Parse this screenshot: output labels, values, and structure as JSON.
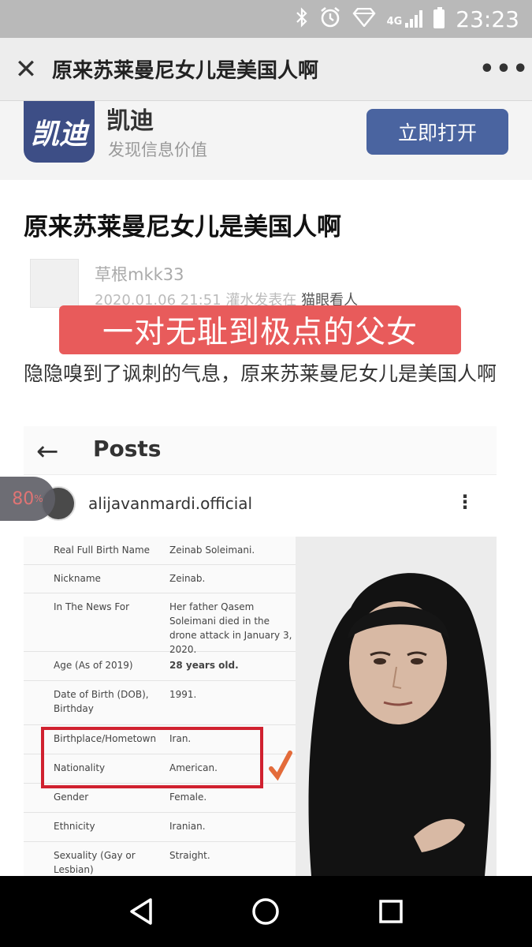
{
  "status_bar": {
    "time": "23:23",
    "network": "4G"
  },
  "title_bar": {
    "close_glyph": "✕",
    "title": "原来苏莱曼尼女儿是美国人啊",
    "more_glyph": "•••"
  },
  "banner": {
    "logo_text": "凯迪",
    "app_name": "凯迪",
    "slogan": "发现信息价值",
    "open_label": "立即打开"
  },
  "article": {
    "title": "原来苏莱曼尼女儿是美国人啊",
    "author": "草根mkk33",
    "meta_prefix": "2020.01.06 21:51 灌水发表在 ",
    "channel": "猫眼看人",
    "caption": "一对无耻到极点的父女",
    "body": "隐隐嗅到了讽刺的气息，原来苏莱曼尼女儿是美国人啊"
  },
  "embed": {
    "back_glyph": "←",
    "title": "Posts",
    "username": "alijavanmardi.official",
    "kebab_glyph": "⋮",
    "rows": [
      {
        "key": "Real Full Birth Name",
        "value": "Zeinab Soleimani."
      },
      {
        "key": "Nickname",
        "value": "Zeinab."
      },
      {
        "key": "In The News For",
        "value": "Her father Qasem Soleimani died in the drone attack in January 3, 2020."
      },
      {
        "key": "Age (As of 2019)",
        "value": "28 years old."
      },
      {
        "key": "Date of Birth (DOB), Birthday",
        "value": "1991."
      },
      {
        "key": "Birthplace/Hometown",
        "value": "Iran."
      },
      {
        "key": "Nationality",
        "value": "American."
      },
      {
        "key": "Gender",
        "value": "Female."
      },
      {
        "key": "Ethnicity",
        "value": "Iranian."
      },
      {
        "key": "Sexuality (Gay or Lesbian)",
        "value": "Straight."
      }
    ]
  },
  "zoom_badge": {
    "value": "80",
    "unit": "%"
  },
  "colors": {
    "accent": "#4a64a0",
    "caption_bg": "#e85b5b",
    "highlight": "#d0212f"
  }
}
